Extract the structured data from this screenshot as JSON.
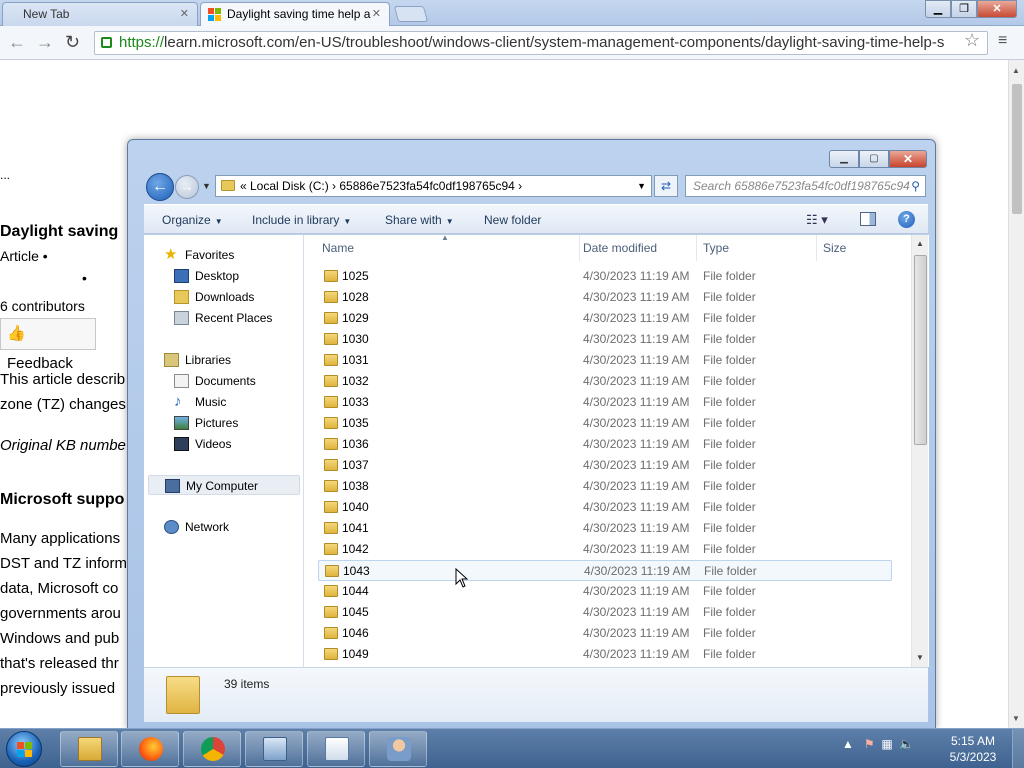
{
  "browser": {
    "tabs": [
      {
        "label": "New Tab"
      },
      {
        "label": "Daylight saving time help a"
      }
    ],
    "url_scheme": "https://",
    "url_rest": "learn.microsoft.com/en-US/troubleshoot/windows-client/system-management-components/daylight-saving-time-help-s"
  },
  "webpage": {
    "ellipsis": "...",
    "heading": "Daylight saving",
    "article": "Article  •",
    "bullet": "•",
    "contributors": "6 contributors",
    "feedback": "Feedback",
    "lines": [
      "This article describ",
      "zone (TZ) changes.",
      "Original KB numbe",
      "Microsoft suppo",
      "Many applications",
      "DST and TZ inform",
      "data, Microsoft co",
      "governments arou",
      "Windows and pub",
      "that's released thr",
      "previously issued"
    ]
  },
  "explorer": {
    "breadcrumb": "«  Local Disk (C:)  ›  65886e7523fa54fc0df198765c94  ›",
    "search_placeholder": "Search 65886e7523fa54fc0df198765c94",
    "commands": {
      "organize": "Organize",
      "include": "Include in library",
      "share": "Share with",
      "newfolder": "New folder"
    },
    "nav": {
      "favorites": "Favorites",
      "desktop": "Desktop",
      "downloads": "Downloads",
      "recent": "Recent Places",
      "libraries": "Libraries",
      "documents": "Documents",
      "music": "Music",
      "pictures": "Pictures",
      "videos": "Videos",
      "computer": "My Computer",
      "network": "Network"
    },
    "columns": {
      "name": "Name",
      "date": "Date modified",
      "type": "Type",
      "size": "Size"
    },
    "files": [
      {
        "name": "1025",
        "date": "4/30/2023 11:19 AM",
        "type": "File folder"
      },
      {
        "name": "1028",
        "date": "4/30/2023 11:19 AM",
        "type": "File folder"
      },
      {
        "name": "1029",
        "date": "4/30/2023 11:19 AM",
        "type": "File folder"
      },
      {
        "name": "1030",
        "date": "4/30/2023 11:19 AM",
        "type": "File folder"
      },
      {
        "name": "1031",
        "date": "4/30/2023 11:19 AM",
        "type": "File folder"
      },
      {
        "name": "1032",
        "date": "4/30/2023 11:19 AM",
        "type": "File folder"
      },
      {
        "name": "1033",
        "date": "4/30/2023 11:19 AM",
        "type": "File folder"
      },
      {
        "name": "1035",
        "date": "4/30/2023 11:19 AM",
        "type": "File folder"
      },
      {
        "name": "1036",
        "date": "4/30/2023 11:19 AM",
        "type": "File folder"
      },
      {
        "name": "1037",
        "date": "4/30/2023 11:19 AM",
        "type": "File folder"
      },
      {
        "name": "1038",
        "date": "4/30/2023 11:19 AM",
        "type": "File folder"
      },
      {
        "name": "1040",
        "date": "4/30/2023 11:19 AM",
        "type": "File folder"
      },
      {
        "name": "1041",
        "date": "4/30/2023 11:19 AM",
        "type": "File folder"
      },
      {
        "name": "1042",
        "date": "4/30/2023 11:19 AM",
        "type": "File folder"
      },
      {
        "name": "1043",
        "date": "4/30/2023 11:19 AM",
        "type": "File folder"
      },
      {
        "name": "1044",
        "date": "4/30/2023 11:19 AM",
        "type": "File folder"
      },
      {
        "name": "1045",
        "date": "4/30/2023 11:19 AM",
        "type": "File folder"
      },
      {
        "name": "1046",
        "date": "4/30/2023 11:19 AM",
        "type": "File folder"
      },
      {
        "name": "1049",
        "date": "4/30/2023 11:19 AM",
        "type": "File folder"
      }
    ],
    "item_count": "39 items"
  },
  "taskbar": {
    "time": "5:15 AM",
    "date": "5/3/2023"
  },
  "icons": {
    "start": "windows-start-orb",
    "explorer": "folder-icon",
    "firefox": "firefox-icon",
    "chrome": "chrome-icon"
  }
}
